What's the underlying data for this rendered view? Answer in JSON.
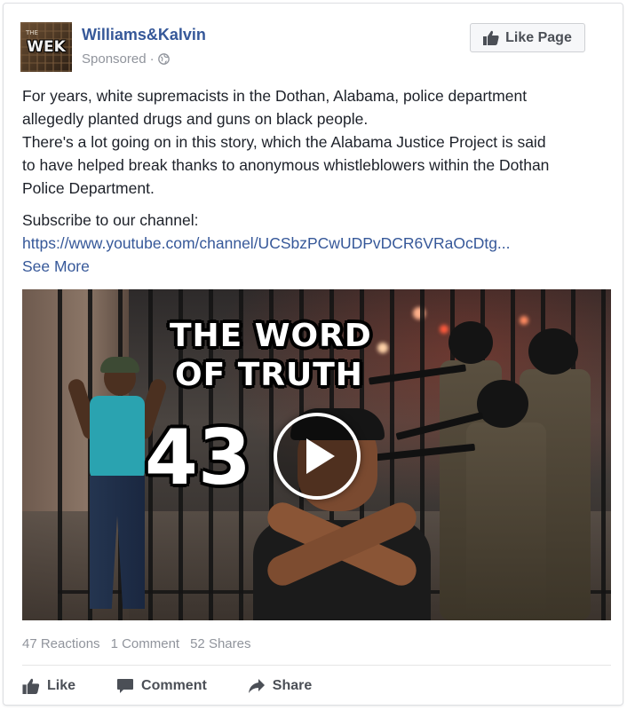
{
  "post": {
    "page_name": "Williams&Kalvin",
    "sponsored_label": "Sponsored",
    "separator": "·",
    "like_page_label": "Like Page",
    "avatar": {
      "logo_text": "WEK",
      "small_text": "THE"
    },
    "body_lines": [
      "For years, white supremacists in the Dothan, Alabama, police department",
      "allegedly planted drugs and guns on black people.",
      "There's a lot going on in this story, which the Alabama Justice Project is said",
      "to have helped break thanks to anonymous whistleblowers within the Dothan",
      "Police Department."
    ],
    "subscribe_text": "Subscribe to our channel:",
    "link_text": "https://www.youtube.com/channel/UCSbzPCwUDPvDCR6VRaOcDtg...",
    "see_more_label": "See More"
  },
  "video": {
    "title_line1": "THE WORD",
    "title_line2": "OF TRUTH",
    "episode_number": "43"
  },
  "stats": {
    "reactions": "47 Reactions",
    "comments": "1 Comment",
    "shares": "52 Shares"
  },
  "actions": {
    "like_label": "Like",
    "comment_label": "Comment",
    "share_label": "Share"
  },
  "colors": {
    "link": "#365899",
    "meta": "#90949c",
    "action_text": "#4b4f56"
  }
}
